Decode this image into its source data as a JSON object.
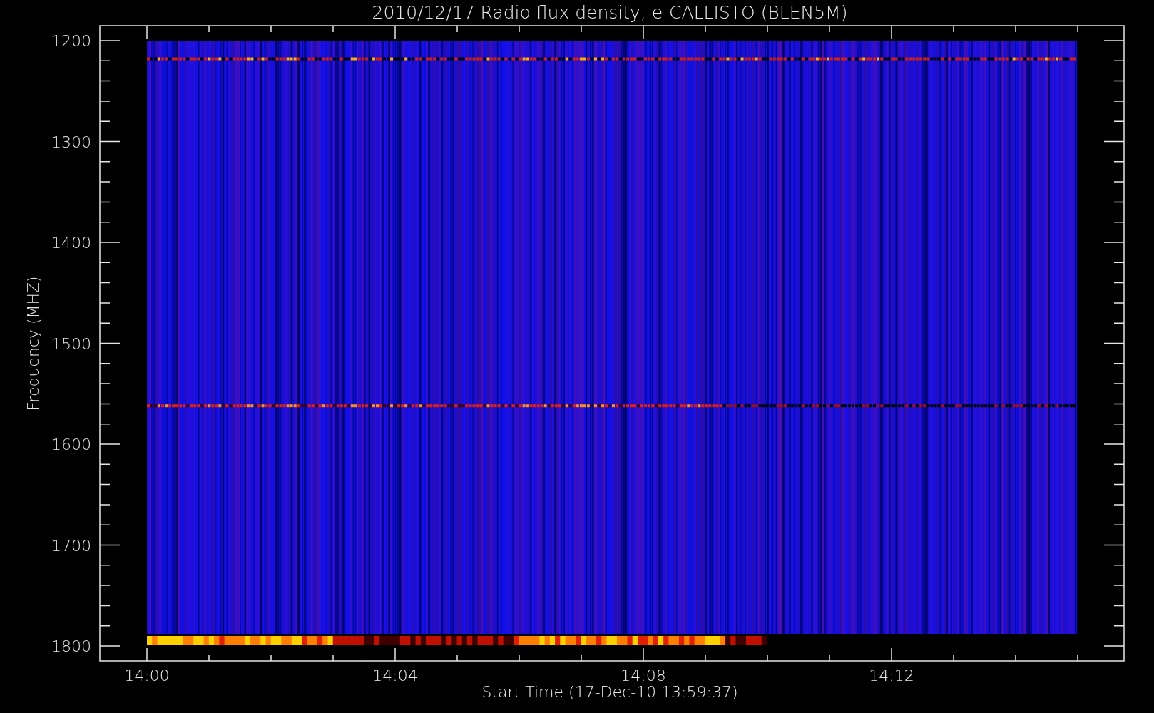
{
  "title": "2010/12/17  Radio flux density, e-CALLISTO (BLEN5M)",
  "plot": {
    "y_axis": {
      "label": "Frequency (MHZ)",
      "ticks": [
        "1200",
        "1300",
        "1400",
        "1500",
        "1600",
        "1700",
        "1800"
      ]
    },
    "x_axis": {
      "label": "Start Time (17-Dec-10 13:59:37)",
      "ticks": [
        "14:00",
        "14:04",
        "14:08",
        "14:12"
      ]
    }
  }
}
